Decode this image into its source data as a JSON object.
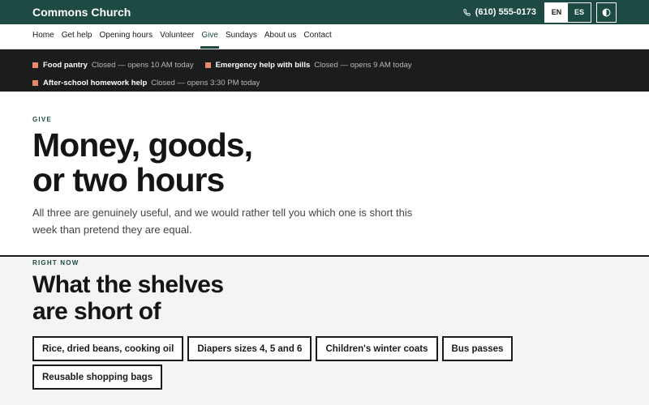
{
  "header": {
    "brand": "Commons Church",
    "phone": "(610) 555-0173",
    "lang_en": "EN",
    "lang_es": "ES",
    "phone_icon": "phone-icon",
    "contrast_icon": "contrast-icon",
    "bg_color": "#1d4a42"
  },
  "nav": {
    "items": [
      "Home",
      "Get help",
      "Opening hours",
      "Volunteer",
      "Give",
      "Sundays",
      "About us",
      "Contact"
    ],
    "active": "Give"
  },
  "status": {
    "items": [
      {
        "name": "Food pantry",
        "note": "Closed — opens 10 AM today"
      },
      {
        "name": "Emergency help with bills",
        "note": "Closed — opens 9 AM today"
      },
      {
        "name": "After-school homework help",
        "note": "Closed — opens 3:30 PM today"
      }
    ],
    "marker_color": "#e88a6a"
  },
  "hero": {
    "eyebrow": "GIVE",
    "title_line1": "Money, goods,",
    "title_line2": "or two hours",
    "subtitle": "All three are genuinely useful, and we would rather tell you which one is short this week than pretend they are equal."
  },
  "needs": {
    "eyebrow": "RIGHT NOW",
    "title_line1": "What the shelves",
    "title_line2": "are short of",
    "chips": [
      "Rice, dried beans, cooking oil",
      "Diapers sizes 4, 5 and 6",
      "Children's winter coats",
      "Bus passes",
      "Reusable shopping bags"
    ]
  }
}
